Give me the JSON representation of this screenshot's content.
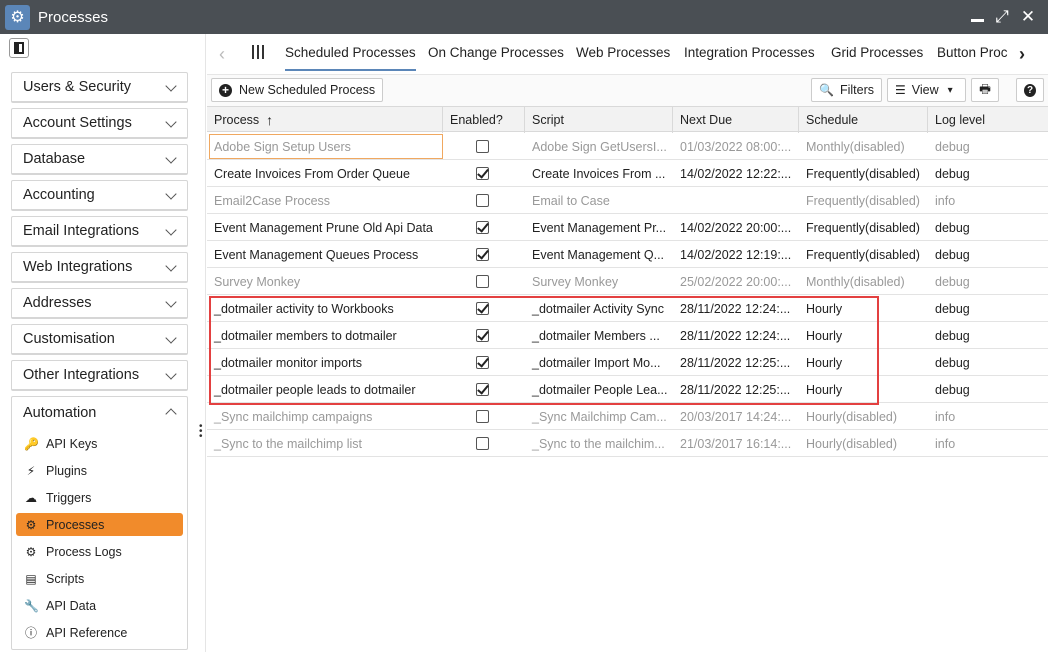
{
  "window": {
    "title": "Processes",
    "icon": "gear-icon"
  },
  "sidebar": {
    "items": [
      {
        "label": "Users & Security"
      },
      {
        "label": "Account Settings"
      },
      {
        "label": "Database"
      },
      {
        "label": "Accounting"
      },
      {
        "label": "Email Integrations"
      },
      {
        "label": "Web Integrations"
      },
      {
        "label": "Addresses"
      },
      {
        "label": "Customisation"
      },
      {
        "label": "Other Integrations"
      }
    ],
    "automation": {
      "label": "Automation",
      "items": [
        {
          "label": "API Keys",
          "icon": "key-icon"
        },
        {
          "label": "Plugins",
          "icon": "plug-icon"
        },
        {
          "label": "Triggers",
          "icon": "cloud-icon"
        },
        {
          "label": "Processes",
          "icon": "gear-icon"
        },
        {
          "label": "Process Logs",
          "icon": "gears-icon"
        },
        {
          "label": "Scripts",
          "icon": "file-icon"
        },
        {
          "label": "API Data",
          "icon": "wrench-icon"
        },
        {
          "label": "API Reference",
          "icon": "info-icon"
        }
      ]
    }
  },
  "tabs": [
    {
      "label": "Scheduled Processes"
    },
    {
      "label": "On Change Processes"
    },
    {
      "label": "Web Processes"
    },
    {
      "label": "Integration Processes"
    },
    {
      "label": "Grid Processes"
    },
    {
      "label": "Button Proc"
    }
  ],
  "toolbar": {
    "new_label": "New Scheduled Process",
    "filters_label": "Filters",
    "view_label": "View"
  },
  "grid": {
    "columns": [
      "Process",
      "Enabled?",
      "Script",
      "Next Due",
      "Schedule",
      "Log level"
    ],
    "rows": [
      {
        "process": "Adobe Sign Setup Users",
        "enabled": false,
        "script": "Adobe Sign GetUsersI...",
        "next_due": "01/03/2022 08:00:...",
        "schedule": "Monthly(disabled)",
        "log": "debug"
      },
      {
        "process": "Create Invoices From Order Queue",
        "enabled": true,
        "script": "Create Invoices From ...",
        "next_due": "14/02/2022 12:22:...",
        "schedule": "Frequently(disabled)",
        "log": "debug"
      },
      {
        "process": "Email2Case Process",
        "enabled": false,
        "script": "Email to Case",
        "next_due": "",
        "schedule": "Frequently(disabled)",
        "log": "info"
      },
      {
        "process": "Event Management Prune Old Api Data",
        "enabled": true,
        "script": "Event Management Pr...",
        "next_due": "14/02/2022 20:00:...",
        "schedule": "Frequently(disabled)",
        "log": "debug"
      },
      {
        "process": "Event Management Queues Process",
        "enabled": true,
        "script": "Event Management Q...",
        "next_due": "14/02/2022 12:19:...",
        "schedule": "Frequently(disabled)",
        "log": "debug"
      },
      {
        "process": "Survey Monkey",
        "enabled": false,
        "script": "Survey Monkey",
        "next_due": "25/02/2022 20:00:...",
        "schedule": "Monthly(disabled)",
        "log": "debug"
      },
      {
        "process": "_dotmailer activity to Workbooks",
        "enabled": true,
        "script": "_dotmailer Activity Sync",
        "next_due": "28/11/2022 12:24:...",
        "schedule": "Hourly",
        "log": "debug"
      },
      {
        "process": "_dotmailer members to dotmailer",
        "enabled": true,
        "script": "_dotmailer Members ...",
        "next_due": "28/11/2022 12:24:...",
        "schedule": "Hourly",
        "log": "debug"
      },
      {
        "process": "_dotmailer monitor imports",
        "enabled": true,
        "script": "_dotmailer Import Mo...",
        "next_due": "28/11/2022 12:25:...",
        "schedule": "Hourly",
        "log": "debug"
      },
      {
        "process": "_dotmailer people leads to dotmailer",
        "enabled": true,
        "script": "_dotmailer People Lea...",
        "next_due": "28/11/2022 12:25:...",
        "schedule": "Hourly",
        "log": "debug"
      },
      {
        "process": "_Sync mailchimp campaigns",
        "enabled": false,
        "script": "_Sync Mailchimp Cam...",
        "next_due": "20/03/2017 14:24:...",
        "schedule": "Hourly(disabled)",
        "log": "info"
      },
      {
        "process": "_Sync to the mailchimp list",
        "enabled": false,
        "script": "_Sync to the mailchim...",
        "next_due": "21/03/2017 16:14:...",
        "schedule": "Hourly(disabled)",
        "log": "info"
      }
    ]
  }
}
